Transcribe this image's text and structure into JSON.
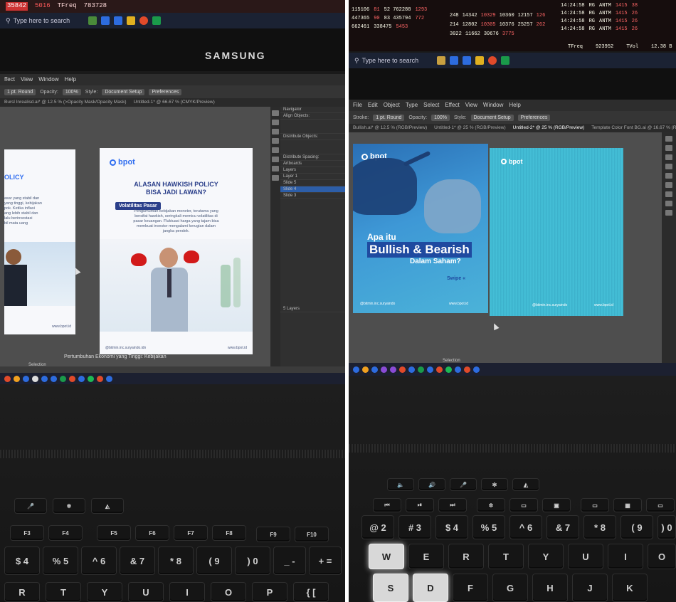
{
  "left_photo": {
    "ticker": [
      "35842",
      "5016",
      "TFreq",
      "783728"
    ],
    "search_placeholder": "Type here to search",
    "monitor_brand": "SAMSUNG",
    "menu": [
      "ffect",
      "View",
      "Window",
      "Help"
    ],
    "control_bar": [
      "1 pt. Round",
      "Opacity:",
      "100%",
      "Style:",
      "Document Setup",
      "Preferences"
    ],
    "tabs": [
      "Bursl Inrealisd.ai* @ 12.5 % (>Opacity Mask/Opacity Mask)",
      "Untitled-1* @ 66.67 % (CMYK/Preview)"
    ],
    "panel_rows": [
      "Navigator",
      "Align Objects:",
      "Distribute Objects:",
      "Distribute Spacing:",
      "Artboards",
      "Layers",
      "Layer 1",
      "Slide 5",
      "Slide 4",
      "Slide 3",
      "5 Layers"
    ],
    "poster_left_partial": {
      "title_fragment": "OLICY",
      "body_lines": [
        "asar yang stabil dan",
        "yang tinggi, kebijakan",
        "pok. Ketika inflasi",
        "ang lebih stabil dan",
        "lalu berinvestasi",
        "bil mata uang"
      ],
      "footer": "www.bpot.id"
    },
    "poster_main": {
      "logo": "bpot",
      "title_line1": "ALASAN HAWKISH POLICY",
      "title_line2": "BISA JADI LAWAN?",
      "chip": "Volatilitas Pasar",
      "body_lines": [
        "Pengumuman kebijakan moneter, terutama yang",
        "bersifat hawkish, seringkali memicu volatilitas di",
        "pasar keuangan. Fluktuasi harga yang tajam bisa",
        "membuat investor mengalami kerugian dalam",
        "jangka pendek."
      ],
      "footer_left": "@bitmin.inc.suryaindo.idn",
      "footer_right": "www.bpot.id"
    },
    "status_text": "Pertumbuhan Ekonomi yang Tinggi: Kebijakan",
    "selection_label": "Selection"
  },
  "right_photo": {
    "ticker_rows": [
      [
        "115106",
        "81",
        "52 762288",
        "1293"
      ],
      [
        "447365",
        "90",
        "83 435794",
        "772"
      ],
      [
        "662461",
        "",
        "338475",
        "5453"
      ]
    ],
    "ticker_mid": [
      [
        "248",
        "14342",
        "10329",
        "10360",
        "12157",
        "126"
      ],
      [
        "214",
        "12802",
        "10305",
        "10376",
        "25257",
        "262"
      ],
      [
        "3022",
        "11662",
        "",
        "",
        "30676",
        "3775"
      ]
    ],
    "ticker_right": [
      [
        "14:24:58",
        "RG",
        "ANTM",
        "1415",
        "38"
      ],
      [
        "14:24:58",
        "RG",
        "ANTM",
        "1415",
        "26"
      ],
      [
        "14:24:58",
        "RG",
        "ANTM",
        "1415",
        "26"
      ],
      [
        "14:24:58",
        "RG",
        "ANTM",
        "1415",
        "26"
      ]
    ],
    "ticker_footer": [
      "TFreq",
      "923952",
      "TVol",
      "12.38 B"
    ],
    "search_placeholder": "Type here to search",
    "menu": [
      "File",
      "Edit",
      "Object",
      "Type",
      "Select",
      "Effect",
      "View",
      "Window",
      "Help"
    ],
    "control_bar": [
      "Stroke:",
      "1 pt. Round",
      "Opacity:",
      "100%",
      "Style:",
      "Document Setup",
      "Preferences"
    ],
    "tabs": [
      "Bullish.ai* @ 12.5 % (RGB/Preview)",
      "Untitled-1* @ 25 % (RGB/Preview)",
      "Untitled-2* @ 25 % (RGB/Preview)",
      "Template Color Font BG.ai @ 16.67 % (RGB/Preview)"
    ],
    "poster_bull": {
      "logo": "bpot",
      "line1": "Apa itu",
      "line2": "Bullish & Bearish",
      "line3": "Dalam Saham?",
      "swipe": "Swipe",
      "handle": "@bitmin.inc.suryaindo",
      "site": "www.bpot.id"
    },
    "poster_wave": {
      "logo": "bpot",
      "handle": "@bitmin.inc.suryaindo",
      "site": "www.bpot.id"
    },
    "selection_label": "Selection"
  },
  "keyboard_left": {
    "row_fn": [
      "F3",
      "F4",
      "F5",
      "F6",
      "F7",
      "F8",
      "F9",
      "F10"
    ],
    "row_num": [
      "$ 4",
      "% 5",
      "^ 6",
      "& 7",
      "* 8",
      "( 9",
      ") 0",
      "_ -",
      "+ ="
    ],
    "row_alpha": [
      "R",
      "T",
      "Y",
      "U",
      "I",
      "O",
      "P",
      "{ ["
    ]
  },
  "keyboard_right": {
    "row_num": [
      "@ 2",
      "# 3",
      "$ 4",
      "% 5",
      "^ 6",
      "& 7",
      "* 8",
      "( 9",
      ") 0"
    ],
    "row_q": [
      "W",
      "E",
      "R",
      "T",
      "Y",
      "U",
      "I",
      "O"
    ],
    "row_a": [
      "S",
      "D",
      "F",
      "G",
      "H",
      "J",
      "K"
    ]
  },
  "colors": {
    "brand_blue": "#2f6df0",
    "navy": "#2b3f8a",
    "ticker_red": "#ff5a5a",
    "glove_red": "#d21a1a"
  }
}
